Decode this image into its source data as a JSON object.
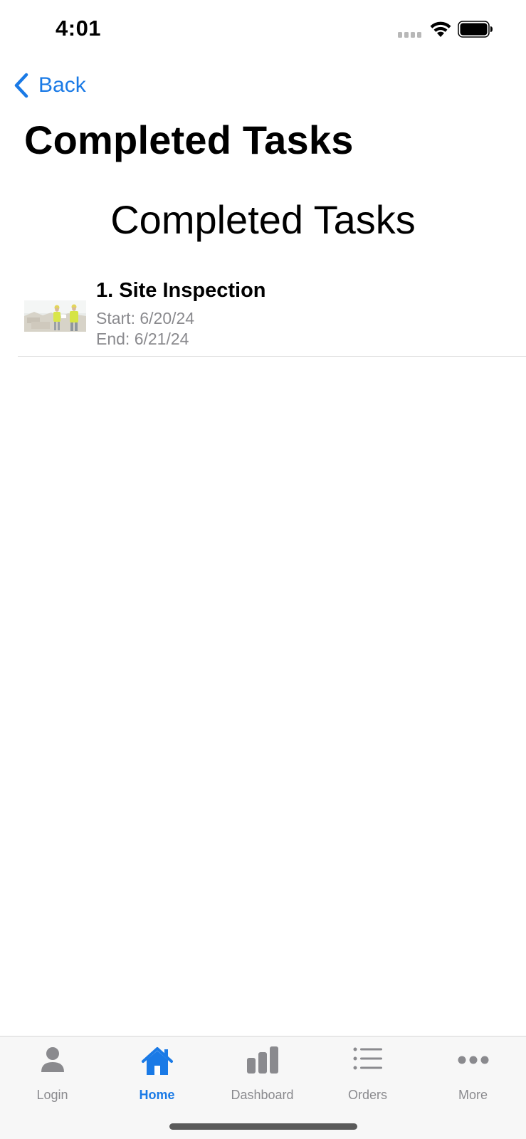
{
  "status_bar": {
    "time": "4:01"
  },
  "nav": {
    "back_label": "Back",
    "large_title": "Completed Tasks"
  },
  "main": {
    "heading": "Completed Tasks",
    "tasks": [
      {
        "title": "1. Site Inspection",
        "start": "Start: 6/20/24",
        "end": "End: 6/21/24",
        "thumbnail": "site-inspection-photo"
      }
    ]
  },
  "tab_bar": {
    "active": "Home",
    "tabs": [
      {
        "label": "Login",
        "icon": "person-icon"
      },
      {
        "label": "Home",
        "icon": "house-icon"
      },
      {
        "label": "Dashboard",
        "icon": "bar-chart-icon"
      },
      {
        "label": "Orders",
        "icon": "list-icon"
      },
      {
        "label": "More",
        "icon": "ellipsis-icon"
      }
    ]
  },
  "colors": {
    "accent": "#1a7ae6",
    "secondary_text": "#8a8a8e",
    "tab_bar_bg": "#f7f7f7"
  }
}
